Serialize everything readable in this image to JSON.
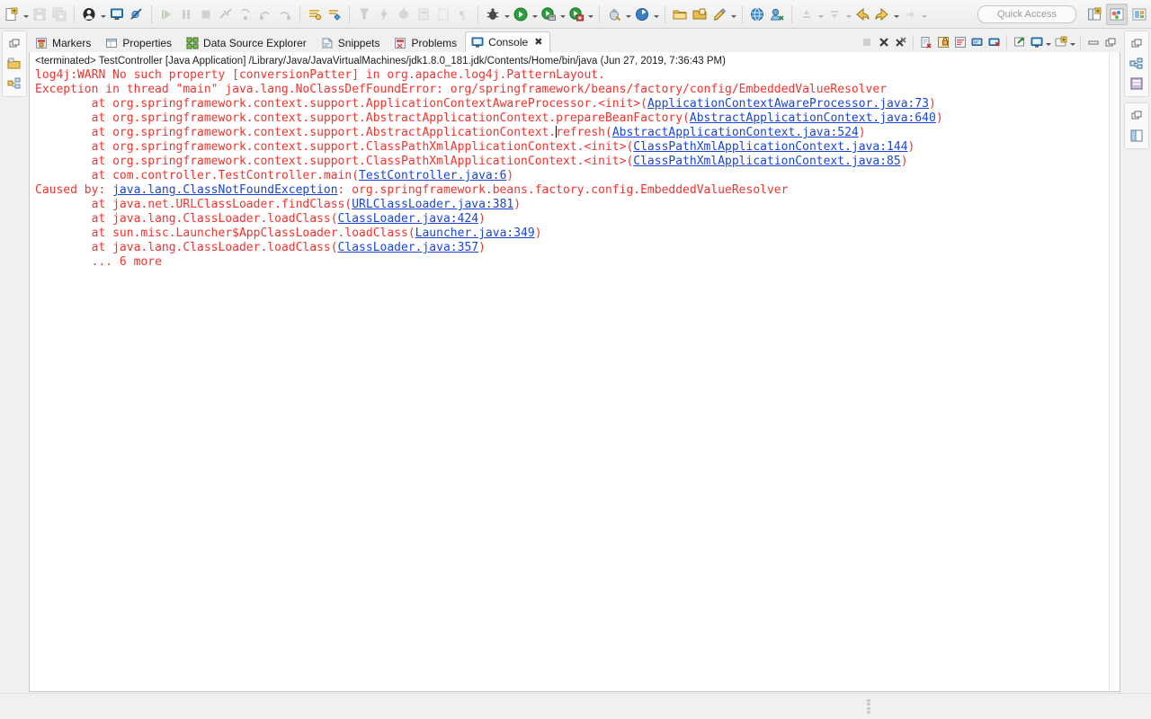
{
  "toolbar": {
    "groups": [
      {
        "name": "file-group",
        "buttons": [
          {
            "name": "new-wizard-button",
            "icon": "new-file-icon",
            "enabled": true,
            "dropdown": true
          },
          {
            "name": "save-button",
            "icon": "save-icon",
            "enabled": false,
            "dropdown": false
          },
          {
            "name": "save-all-button",
            "icon": "save-all-icon",
            "enabled": false,
            "dropdown": false
          }
        ]
      },
      {
        "name": "print-group",
        "buttons": [
          {
            "name": "user-button",
            "icon": "user-icon",
            "enabled": true,
            "dropdown": true
          },
          {
            "name": "open-console-button",
            "icon": "console-icon",
            "enabled": true,
            "dropdown": false
          },
          {
            "name": "skip-breakpoints-button",
            "icon": "skip-breakpoints-icon",
            "enabled": true,
            "dropdown": false
          }
        ]
      },
      {
        "name": "debug-control-group",
        "buttons": [
          {
            "name": "resume-button",
            "icon": "resume-icon",
            "enabled": false,
            "dropdown": false
          },
          {
            "name": "suspend-button",
            "icon": "suspend-icon",
            "enabled": false,
            "dropdown": false
          },
          {
            "name": "terminate-button",
            "icon": "terminate-icon",
            "enabled": false,
            "dropdown": false
          },
          {
            "name": "disconnect-button",
            "icon": "disconnect-icon",
            "enabled": false,
            "dropdown": false
          },
          {
            "name": "step-into-button",
            "icon": "step-into-icon",
            "enabled": false,
            "dropdown": false
          },
          {
            "name": "step-over-button",
            "icon": "step-over-icon",
            "enabled": false,
            "dropdown": false
          },
          {
            "name": "step-return-button",
            "icon": "step-return-icon",
            "enabled": false,
            "dropdown": false
          }
        ]
      },
      {
        "name": "build-group",
        "buttons": [
          {
            "name": "build-all-button",
            "icon": "build-icon",
            "enabled": true,
            "dropdown": false
          },
          {
            "name": "build-project-button",
            "icon": "build-project-icon",
            "enabled": true,
            "dropdown": false
          }
        ]
      },
      {
        "name": "search-group",
        "buttons": [
          {
            "name": "search-button",
            "icon": "search-icon",
            "enabled": false,
            "dropdown": false
          },
          {
            "name": "run-last-tool-button",
            "icon": "lightning-icon",
            "enabled": false,
            "dropdown": false
          },
          {
            "name": "external-tools-button",
            "icon": "external-tools-icon",
            "enabled": false,
            "dropdown": false
          },
          {
            "name": "toggle-mark-occurrences-button",
            "icon": "mark-occurrences-icon",
            "enabled": false,
            "dropdown": false
          },
          {
            "name": "toggle-block-selection-button",
            "icon": "block-selection-icon",
            "enabled": false,
            "dropdown": false
          },
          {
            "name": "show-whitespace-button",
            "icon": "pilcrow-icon",
            "enabled": false,
            "dropdown": false
          }
        ]
      },
      {
        "name": "launch-group",
        "buttons": [
          {
            "name": "debug-button",
            "icon": "bug-icon",
            "enabled": true,
            "dropdown": true
          },
          {
            "name": "run-button",
            "icon": "run-icon",
            "enabled": true,
            "dropdown": true
          },
          {
            "name": "run-server-button",
            "icon": "run-server-icon",
            "enabled": true,
            "dropdown": true
          },
          {
            "name": "debug-server-button",
            "icon": "debug-server-icon",
            "enabled": true,
            "dropdown": true
          }
        ]
      },
      {
        "name": "coverage-group",
        "buttons": [
          {
            "name": "coverage-button",
            "icon": "coverage-icon",
            "enabled": true,
            "dropdown": true
          },
          {
            "name": "profile-button",
            "icon": "profile-icon",
            "enabled": true,
            "dropdown": true
          }
        ]
      },
      {
        "name": "package-group",
        "buttons": [
          {
            "name": "new-java-package-button",
            "icon": "package-icon",
            "enabled": true,
            "dropdown": false
          },
          {
            "name": "new-java-class-button",
            "icon": "class-icon",
            "enabled": true,
            "dropdown": false
          },
          {
            "name": "new-annotation-button",
            "icon": "annotation-icon",
            "enabled": true,
            "dropdown": true
          }
        ]
      },
      {
        "name": "web-group",
        "buttons": [
          {
            "name": "open-browser-button",
            "icon": "globe-icon",
            "enabled": true,
            "dropdown": false
          },
          {
            "name": "open-type-button",
            "icon": "open-type-icon",
            "enabled": true,
            "dropdown": false
          }
        ]
      },
      {
        "name": "nav-group",
        "buttons": [
          {
            "name": "previous-annotation-button",
            "icon": "previous-annotation-icon",
            "enabled": false,
            "dropdown": true
          },
          {
            "name": "next-annotation-button",
            "icon": "next-annotation-icon",
            "enabled": false,
            "dropdown": true
          },
          {
            "name": "back-button",
            "icon": "back-arrow-icon",
            "enabled": true,
            "dropdown": false
          },
          {
            "name": "forward-button",
            "icon": "forward-arrow-icon",
            "enabled": true,
            "dropdown": true
          },
          {
            "name": "next-edit-button",
            "icon": "next-edit-icon",
            "enabled": false,
            "dropdown": true
          }
        ]
      }
    ],
    "quick_access_placeholder": "Quick Access",
    "perspective_buttons": [
      {
        "name": "open-perspective-button",
        "icon": "open-perspective-icon",
        "active": false
      },
      {
        "name": "perspective-java-ee-button",
        "icon": "java-ee-perspective-icon",
        "active": true
      },
      {
        "name": "perspective-java-button",
        "icon": "java-perspective-icon",
        "active": false
      }
    ]
  },
  "left_fastview": {
    "stacks": [
      {
        "name": "left-view-stack",
        "icons": [
          {
            "name": "restore-icon"
          },
          {
            "name": "project-explorer-icon"
          },
          {
            "name": "outline-icon"
          }
        ]
      }
    ]
  },
  "right_fastview": {
    "stacks": [
      {
        "name": "right-view-stack-top",
        "icons": [
          {
            "name": "restore-icon"
          },
          {
            "name": "task-list-icon"
          },
          {
            "name": "palette-icon"
          }
        ]
      },
      {
        "name": "right-view-stack-bottom",
        "icons": [
          {
            "name": "restore-icon"
          },
          {
            "name": "outline-view-icon"
          }
        ]
      }
    ]
  },
  "tabs": [
    {
      "name": "tab-markers",
      "label": "Markers",
      "icon": "markers-icon",
      "active": false
    },
    {
      "name": "tab-properties",
      "label": "Properties",
      "icon": "properties-icon",
      "active": false
    },
    {
      "name": "tab-data-source-explorer",
      "label": "Data Source Explorer",
      "icon": "data-source-icon",
      "active": false
    },
    {
      "name": "tab-snippets",
      "label": "Snippets",
      "icon": "snippets-icon",
      "active": false
    },
    {
      "name": "tab-problems",
      "label": "Problems",
      "icon": "problems-icon",
      "active": false
    },
    {
      "name": "tab-console",
      "label": "Console",
      "icon": "console-tab-icon",
      "active": true,
      "close_glyph": "✖"
    }
  ],
  "view_toolbar": {
    "buttons": [
      {
        "name": "terminate-button",
        "icon": "terminate-icon",
        "enabled": false
      },
      {
        "name": "remove-launch-button",
        "icon": "remove-launch-icon",
        "enabled": true
      },
      {
        "name": "remove-all-terminated-button",
        "icon": "remove-all-terminated-icon",
        "enabled": true
      },
      {
        "name": "clear-console-button",
        "icon": "clear-console-icon",
        "enabled": true
      },
      {
        "name": "scroll-lock-button",
        "icon": "scroll-lock-icon",
        "enabled": true
      },
      {
        "name": "word-wrap-button",
        "icon": "word-wrap-icon",
        "enabled": true
      },
      {
        "name": "show-console-on-output-button",
        "icon": "show-console-output-icon",
        "enabled": true
      },
      {
        "name": "show-console-on-error-button",
        "icon": "show-console-error-icon",
        "enabled": true
      },
      {
        "name": "pin-console-button",
        "icon": "pin-icon",
        "enabled": true
      },
      {
        "name": "display-selected-console-button",
        "icon": "display-console-icon",
        "enabled": true,
        "dropdown": true
      },
      {
        "name": "open-console-button",
        "icon": "new-console-icon",
        "enabled": true,
        "dropdown": true
      },
      {
        "name": "minimize-button",
        "icon": "minimize-icon",
        "enabled": true
      },
      {
        "name": "maximize-button",
        "icon": "maximize-icon",
        "enabled": true
      }
    ]
  },
  "console": {
    "header": "<terminated> TestController [Java Application] /Library/Java/JavaVirtualMachines/jdk1.8.0_181.jdk/Contents/Home/bin/java (Jun 27, 2019, 7:36:43 PM)",
    "text_color": "#f0342e",
    "link_color": "#1a46d8",
    "lines": [
      {
        "indent": 0,
        "segments": [
          {
            "t": "log4j:WARN No such property [conversionPatter] in org.apache.log4j.PatternLayout.",
            "link": false
          }
        ]
      },
      {
        "indent": 0,
        "segments": [
          {
            "t": "Exception in thread \"main\" java.lang.NoClassDefFoundError: org/springframework/beans/factory/config/EmbeddedValueResolver",
            "link": false
          }
        ]
      },
      {
        "indent": 1,
        "segments": [
          {
            "t": "at org.springframework.context.support.ApplicationContextAwareProcessor.<init>(",
            "link": false
          },
          {
            "t": "ApplicationContextAwareProcessor.java:73",
            "link": true
          },
          {
            "t": ")",
            "link": false
          }
        ]
      },
      {
        "indent": 1,
        "segments": [
          {
            "t": "at org.springframework.context.support.AbstractApplicationContext.prepareBeanFactory(",
            "link": false
          },
          {
            "t": "AbstractApplicationContext.java:640",
            "link": true
          },
          {
            "t": ")",
            "link": false
          }
        ]
      },
      {
        "indent": 1,
        "caret_after": "at org.springframework.context.support.AbstractApplicationContext.",
        "segments": [
          {
            "t": "at org.springframework.context.support.AbstractApplicationContext.",
            "link": false
          },
          {
            "t": "CARET",
            "caret": true
          },
          {
            "t": "refresh(",
            "link": false
          },
          {
            "t": "AbstractApplicationContext.java:524",
            "link": true
          },
          {
            "t": ")",
            "link": false
          }
        ]
      },
      {
        "indent": 1,
        "segments": [
          {
            "t": "at org.springframework.context.support.ClassPathXmlApplicationContext.<init>(",
            "link": false
          },
          {
            "t": "ClassPathXmlApplicationContext.java:144",
            "link": true
          },
          {
            "t": ")",
            "link": false
          }
        ]
      },
      {
        "indent": 1,
        "segments": [
          {
            "t": "at org.springframework.context.support.ClassPathXmlApplicationContext.<init>(",
            "link": false
          },
          {
            "t": "ClassPathXmlApplicationContext.java:85",
            "link": true
          },
          {
            "t": ")",
            "link": false
          }
        ]
      },
      {
        "indent": 1,
        "segments": [
          {
            "t": "at com.controller.TestController.main(",
            "link": false
          },
          {
            "t": "TestController.java:6",
            "link": true
          },
          {
            "t": ")",
            "link": false
          }
        ]
      },
      {
        "indent": 0,
        "segments": [
          {
            "t": "Caused by: ",
            "link": false
          },
          {
            "t": "java.lang.ClassNotFoundException",
            "link": true
          },
          {
            "t": ": org.springframework.beans.factory.config.EmbeddedValueResolver",
            "link": false
          }
        ]
      },
      {
        "indent": 1,
        "segments": [
          {
            "t": "at java.net.URLClassLoader.findClass(",
            "link": false
          },
          {
            "t": "URLClassLoader.java:381",
            "link": true
          },
          {
            "t": ")",
            "link": false
          }
        ]
      },
      {
        "indent": 1,
        "segments": [
          {
            "t": "at java.lang.ClassLoader.loadClass(",
            "link": false
          },
          {
            "t": "ClassLoader.java:424",
            "link": true
          },
          {
            "t": ")",
            "link": false
          }
        ]
      },
      {
        "indent": 1,
        "segments": [
          {
            "t": "at sun.misc.Launcher$AppClassLoader.loadClass(",
            "link": false
          },
          {
            "t": "Launcher.java:349",
            "link": true
          },
          {
            "t": ")",
            "link": false
          }
        ]
      },
      {
        "indent": 1,
        "segments": [
          {
            "t": "at java.lang.ClassLoader.loadClass(",
            "link": false
          },
          {
            "t": "ClassLoader.java:357",
            "link": true
          },
          {
            "t": ")",
            "link": false
          }
        ]
      },
      {
        "indent": 1,
        "segments": [
          {
            "t": "... 6 more",
            "link": false
          }
        ]
      }
    ]
  },
  "statusbar": {
    "grip_name": "resize-grip"
  }
}
